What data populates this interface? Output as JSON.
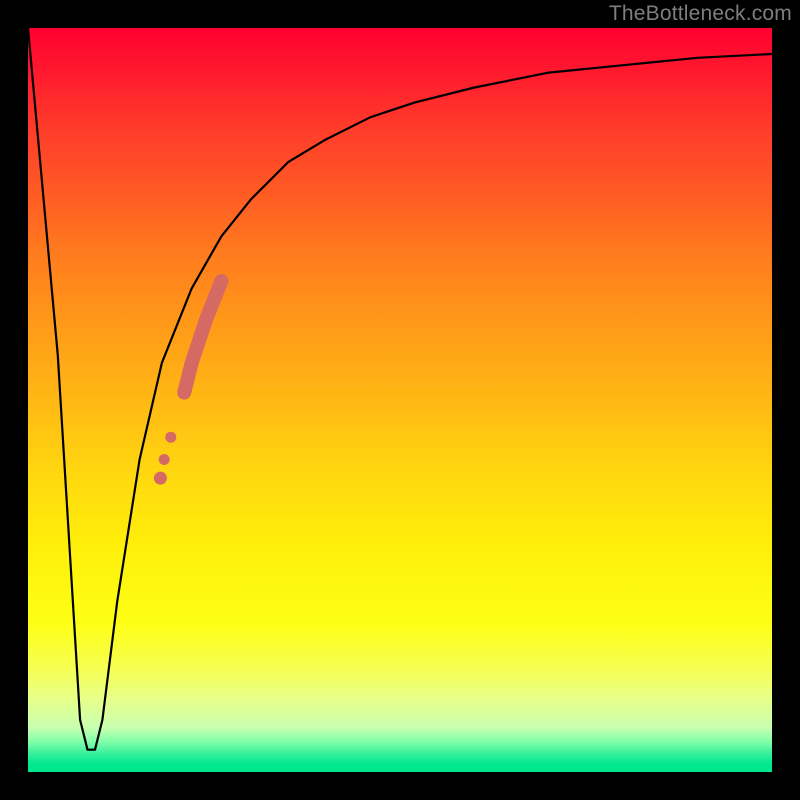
{
  "watermark": "TheBottleneck.com",
  "colors": {
    "frame": "#000000",
    "curve": "#000000",
    "markers": "#d46a63",
    "gradient_top": "#ff0030",
    "gradient_bottom": "#00e78e"
  },
  "chart_data": {
    "type": "line",
    "title": "",
    "xlabel": "",
    "ylabel": "",
    "xlim": [
      0,
      100
    ],
    "ylim": [
      0,
      100
    ],
    "grid": false,
    "legend": false,
    "series": [
      {
        "name": "bottleneck-curve",
        "x": [
          0,
          4,
          7,
          8,
          9,
          10,
          12,
          15,
          18,
          22,
          26,
          30,
          35,
          40,
          46,
          52,
          60,
          70,
          80,
          90,
          100
        ],
        "y": [
          100,
          56,
          7,
          3,
          3,
          7,
          23,
          42,
          55,
          65,
          72,
          77,
          82,
          85,
          88,
          90,
          92,
          94,
          95,
          96,
          96.5
        ]
      }
    ],
    "markers": {
      "name": "highlighted-segment",
      "x": [
        17.8,
        18.3,
        19.2,
        21.0,
        22.0,
        23.0,
        24.0,
        25.0,
        26.0
      ],
      "y": [
        39.5,
        42.0,
        45.0,
        51.0,
        55.0,
        58.0,
        61.0,
        63.5,
        66.0
      ],
      "style": "thick-round-overlay"
    },
    "background": {
      "type": "vertical-gradient",
      "stops": [
        {
          "pos": 0.0,
          "color": "#ff0030"
        },
        {
          "pos": 0.5,
          "color": "#ffb814"
        },
        {
          "pos": 0.8,
          "color": "#fdff14"
        },
        {
          "pos": 0.97,
          "color": "#38ef9d"
        },
        {
          "pos": 1.0,
          "color": "#00e78e"
        }
      ]
    }
  }
}
